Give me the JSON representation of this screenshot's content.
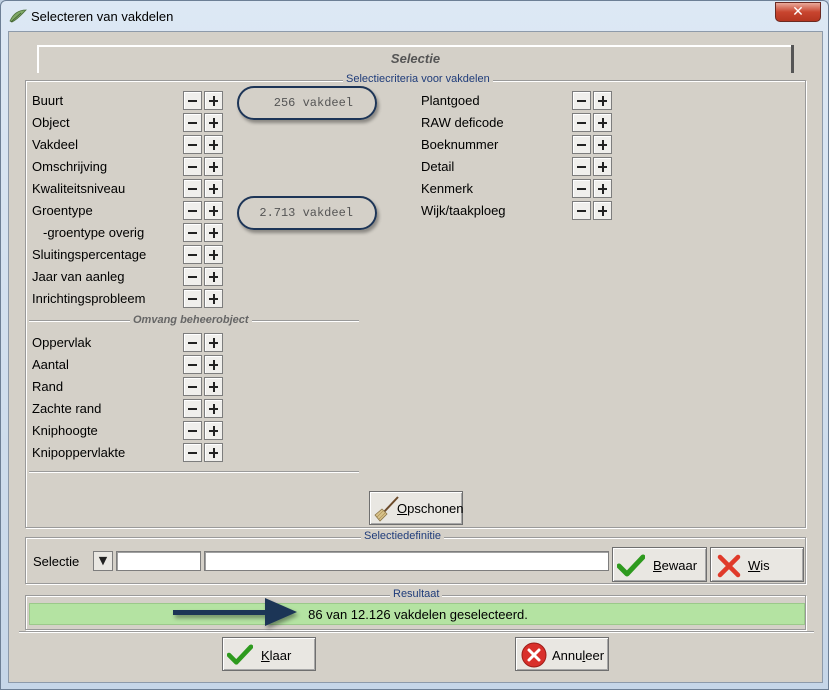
{
  "window": {
    "title": "Selecteren van vakdelen",
    "close_label": "✕"
  },
  "tab": {
    "label": "Selectie"
  },
  "criteria": {
    "legend": "Selectiecriteria voor vakdelen",
    "left": [
      "Buurt",
      "Object",
      "Vakdeel",
      "Omschrijving",
      "Kwaliteitsniveau",
      "Groentype",
      "-groentype overig",
      "Sluitingspercentage",
      "Jaar van aanleg",
      "Inrichtingsprobleem"
    ],
    "right": [
      "Plantgoed",
      "RAW deficode",
      "Boeknummer",
      "Detail",
      "Kenmerk",
      "Wijk/taakploeg"
    ],
    "omvang_heading": "Omvang beheerobject",
    "omvang": [
      "Oppervlak",
      "Aantal",
      "Rand",
      "Zachte rand",
      "Kniphoogte",
      "Knipoppervlakte"
    ],
    "count_buurt": "256 vakdeel",
    "count_groentype": "2.713 vakdeel",
    "clear_button": {
      "underline": "O",
      "rest": "pschonen"
    }
  },
  "definition": {
    "legend": "Selectiedefinitie",
    "label": "Selectie",
    "dropdown_glyph": "▼",
    "code_value": "",
    "name_value": "",
    "save_button": {
      "underline": "B",
      "rest": "ewaar"
    },
    "delete_button": {
      "underline": "W",
      "rest": "is"
    }
  },
  "result": {
    "legend": "Resultaat",
    "text": "86 van 12.126 vakdelen geselecteerd."
  },
  "footer": {
    "ok_button": {
      "underline": "K",
      "rest": "laar",
      "prefix": ""
    },
    "cancel_button": {
      "prefix": "Annu",
      "underline": "l",
      "rest": "eer"
    }
  },
  "colors": {
    "accent": "#1d3557",
    "result_bg": "#b4e3a2",
    "check": "#2e9a1e",
    "cancel": "#d9302b"
  }
}
